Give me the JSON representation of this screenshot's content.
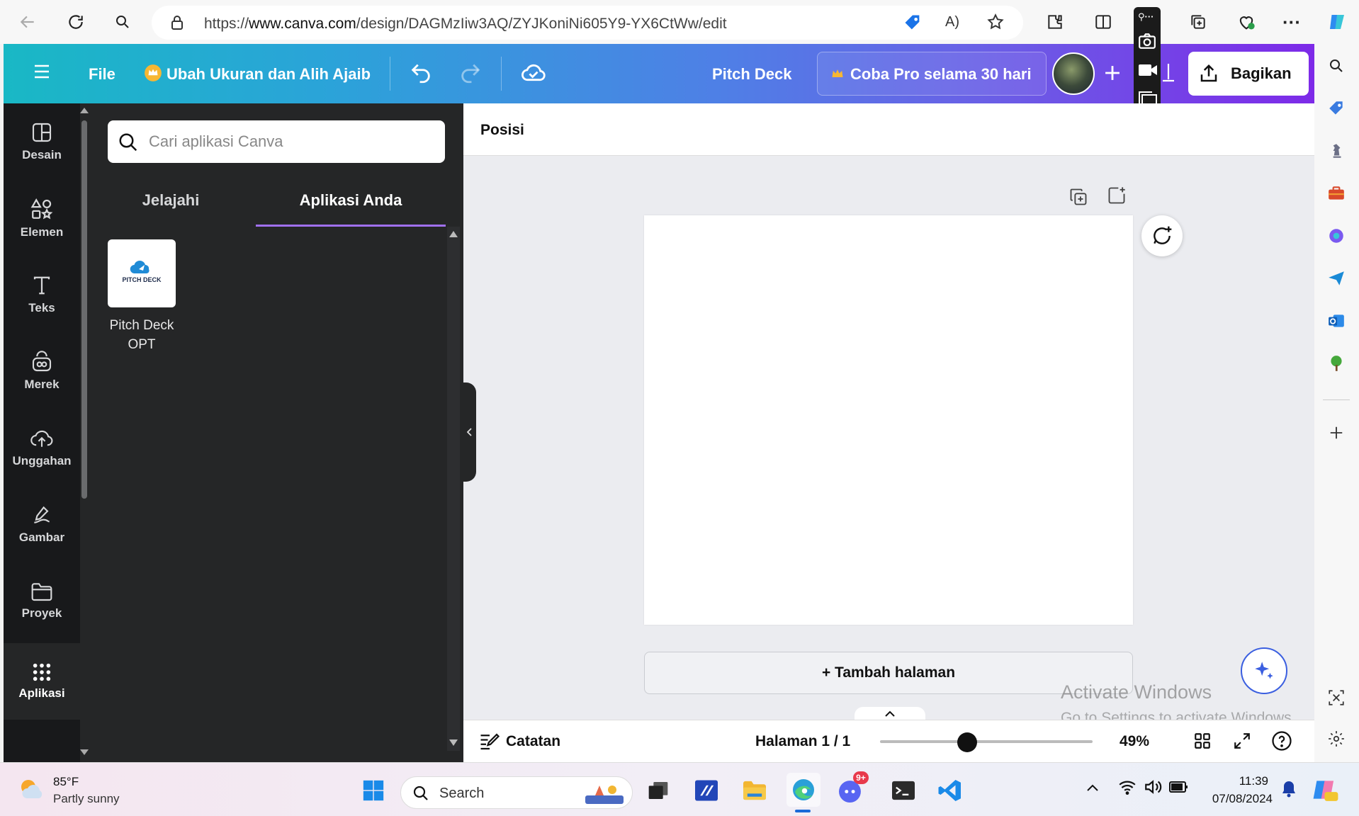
{
  "browser": {
    "url_prefix": "https://",
    "url_domain": "www.canva.com",
    "url_path": "/design/DAGMzIiw3AQ/ZYJKoniNi605Y9-YX6CtWw/edit"
  },
  "header": {
    "file_label": "File",
    "resize_label": "Ubah Ukuran dan Alih Ajaib",
    "doc_title": "Pitch Deck",
    "pro_label": "Coba Pro selama 30 hari",
    "share_label": "Bagikan"
  },
  "rail": {
    "items": [
      {
        "label": "Desain"
      },
      {
        "label": "Elemen"
      },
      {
        "label": "Teks"
      },
      {
        "label": "Merek"
      },
      {
        "label": "Unggahan"
      },
      {
        "label": "Gambar"
      },
      {
        "label": "Proyek"
      },
      {
        "label": "Aplikasi"
      }
    ]
  },
  "panel": {
    "search_placeholder": "Cari aplikasi Canva",
    "tabs": [
      {
        "label": "Jelajahi"
      },
      {
        "label": "Aplikasi Anda"
      }
    ],
    "app": {
      "name_line1": "Pitch Deck",
      "name_line2": "OPT",
      "logo_text": "PITCH DECK"
    }
  },
  "canvas": {
    "position_label": "Posisi",
    "add_page_label": "+ Tambah halaman"
  },
  "bottom": {
    "notes_label": "Catatan",
    "page_indicator": "Halaman 1 / 1",
    "zoom": "49%",
    "zoom_fraction": 0.49
  },
  "watermark": {
    "line1": "Activate Windows",
    "line2": "Go to Settings to activate Windows."
  },
  "taskbar": {
    "weather_temp": "85°F",
    "weather_desc": "Partly sunny",
    "search_label": "Search",
    "time": "11:39",
    "date": "07/08/2024",
    "discord_badge": "9+"
  },
  "colors": {
    "accent": "#7d2ae8",
    "teal": "#19b8c5",
    "panel_bg": "#252627",
    "rail_bg": "#18191b"
  }
}
